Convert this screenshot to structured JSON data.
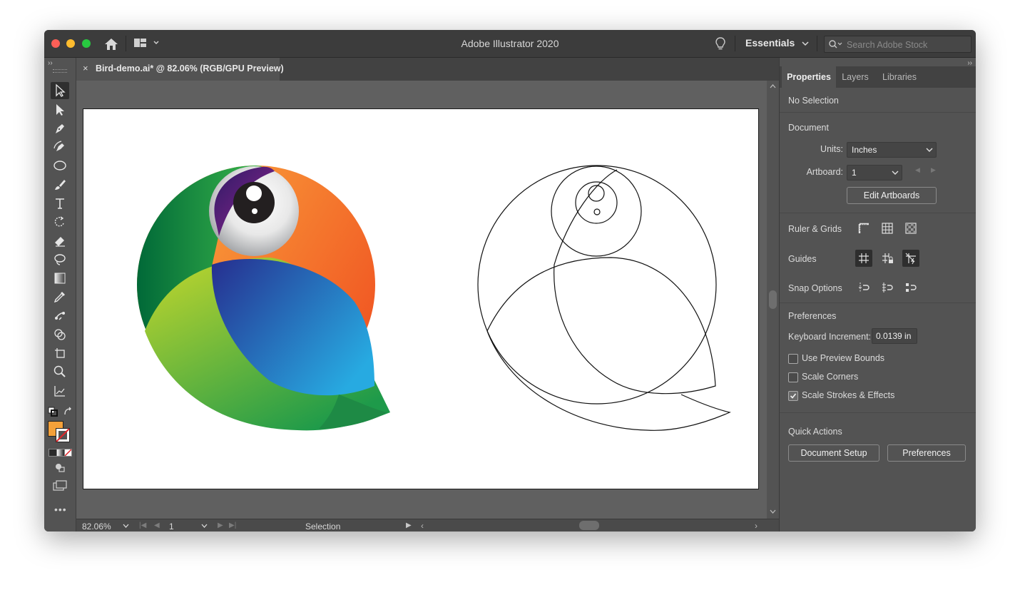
{
  "window": {
    "app_title": "Adobe Illustrator 2020",
    "workspace": "Essentials",
    "search_placeholder": "Search Adobe Stock"
  },
  "document_tab": {
    "close_glyph": "×",
    "label": "Bird-demo.ai* @ 82.06% (RGB/GPU Preview)"
  },
  "toolbar": {
    "tools": [
      "selection-tool",
      "direct-selection-tool",
      "pen-tool",
      "curvature-tool",
      "ellipse-tool",
      "paintbrush-tool",
      "type-tool",
      "rotate-tool",
      "eraser-tool",
      "lasso-tool",
      "gradient-tool",
      "eyedropper-tool",
      "blend-tool",
      "shape-builder-tool",
      "artboard-tool",
      "zoom-tool",
      "graph-tool"
    ],
    "fill_color": "#f5a13a",
    "stroke_color": "none"
  },
  "status_bar": {
    "zoom": "82.06%",
    "artboard_number": "1",
    "current_tool": "Selection"
  },
  "properties_panel": {
    "tabs": [
      "Properties",
      "Layers",
      "Libraries"
    ],
    "active_tab": "Properties",
    "selection": "No Selection",
    "document_heading": "Document",
    "units_label": "Units:",
    "units_value": "Inches",
    "artboard_label": "Artboard:",
    "artboard_value": "1",
    "edit_artboards": "Edit Artboards",
    "ruler_grids": "Ruler & Grids",
    "guides": "Guides",
    "snap_options": "Snap Options",
    "preferences_heading": "Preferences",
    "keyboard_increment_label": "Keyboard Increment:",
    "keyboard_increment_value": "0.0139 in",
    "checkboxes": [
      {
        "label": "Use Preview Bounds",
        "checked": false
      },
      {
        "label": "Scale Corners",
        "checked": false
      },
      {
        "label": "Scale Strokes & Effects",
        "checked": true
      }
    ],
    "quick_actions_heading": "Quick Actions",
    "document_setup_button": "Document Setup",
    "preferences_button": "Preferences"
  },
  "colors": {
    "chrome": "#535353",
    "titlebar": "#3c3c3c",
    "bird_green": "#1f8a3e",
    "bird_orange": "#f47f2a",
    "bird_blue": "#2a6cc0",
    "bird_purple": "#5b2a8a"
  }
}
